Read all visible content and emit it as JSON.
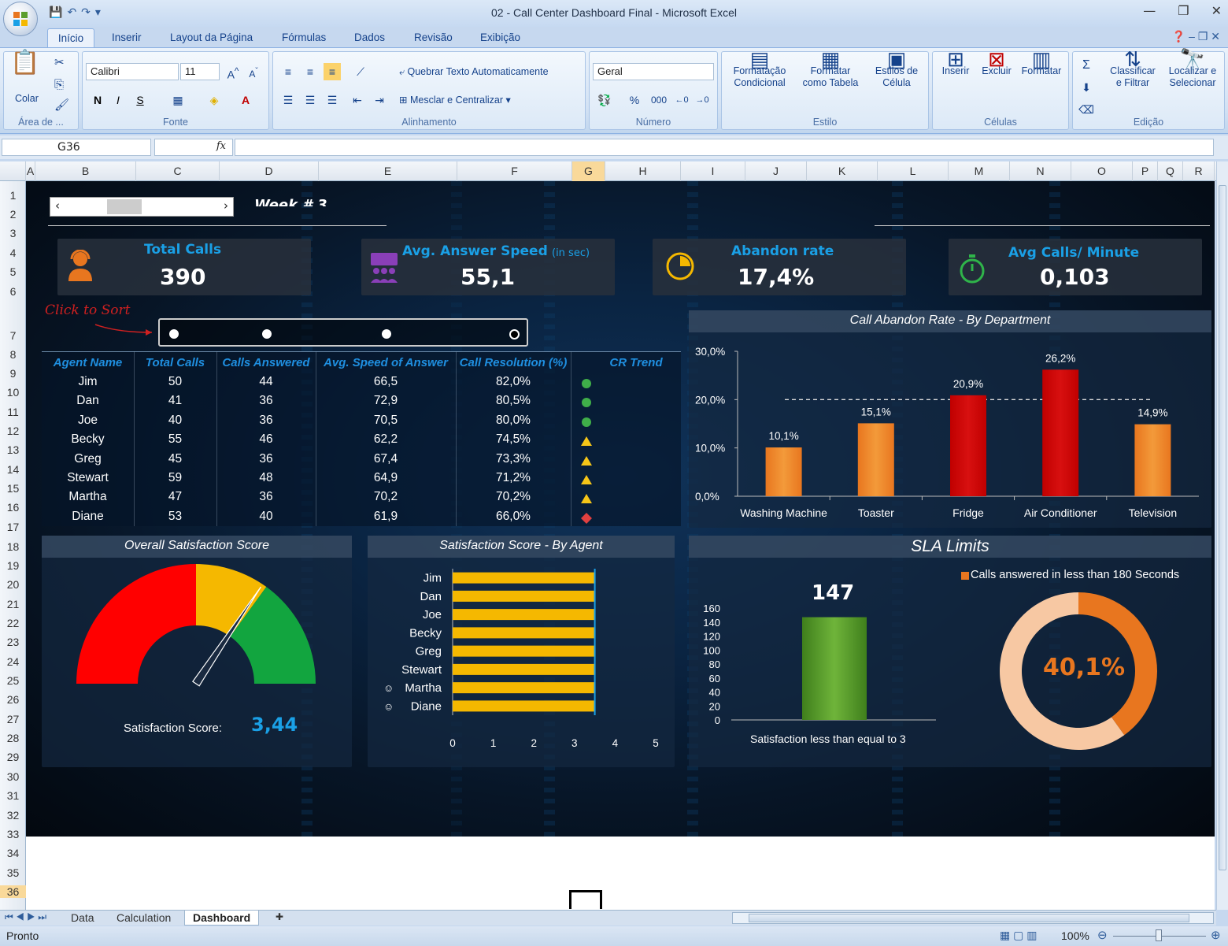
{
  "window": {
    "title": "02 - Call Center Dashboard Final - Microsoft Excel"
  },
  "ribbon": {
    "tabs": [
      "Início",
      "Inserir",
      "Layout da Página",
      "Fórmulas",
      "Dados",
      "Revisão",
      "Exibição"
    ],
    "clipboard": {
      "paste": "Colar",
      "group": "Área de ..."
    },
    "font": {
      "name": "Calibri",
      "size": "11",
      "bold": "N",
      "italic": "I",
      "underline": "S",
      "group": "Fonte"
    },
    "alignment": {
      "wrap": "Quebrar Texto Automaticamente",
      "merge": "Mesclar e Centralizar",
      "group": "Alinhamento"
    },
    "number": {
      "format": "Geral",
      "percent": "%",
      "thousands": "000",
      "group": "Número"
    },
    "styles": {
      "cond_1": "Formatação",
      "cond_2": "Condicional",
      "table_1": "Formatar",
      "table_2": "como Tabela",
      "cell_1": "Estilos de",
      "cell_2": "Célula",
      "group": "Estilo"
    },
    "cells": {
      "insert": "Inserir",
      "delete": "Excluir",
      "format": "Formatar",
      "group": "Células"
    },
    "editing": {
      "sort_1": "Classificar",
      "sort_2": "e Filtrar",
      "find_1": "Localizar e",
      "find_2": "Selecionar",
      "group": "Edição"
    }
  },
  "formula_bar": {
    "name_box": "G36",
    "fx": "fx",
    "formula": ""
  },
  "columns": [
    "A",
    "B",
    "C",
    "D",
    "E",
    "F",
    "G",
    "H",
    "I",
    "J",
    "K",
    "L",
    "M",
    "N",
    "O",
    "P",
    "Q",
    "R"
  ],
  "rows": [
    "1",
    "2",
    "3",
    "4",
    "5",
    "6",
    "7",
    "8",
    "9",
    "10",
    "11",
    "12",
    "13",
    "14",
    "15",
    "16",
    "17",
    "18",
    "19",
    "20",
    "21",
    "22",
    "23",
    "24",
    "25",
    "26",
    "27",
    "28",
    "29",
    "30",
    "31",
    "32",
    "33",
    "34",
    "35",
    "36"
  ],
  "dashboard": {
    "week": "Week # 3",
    "kpis": [
      {
        "title": "Total Calls",
        "value": "390",
        "unit": ""
      },
      {
        "title": "Avg. Answer Speed",
        "value": "55,1",
        "unit": "(in sec)"
      },
      {
        "title": "Abandon rate",
        "value": "17,4%",
        "unit": ""
      },
      {
        "title": "Avg Calls/ Minute",
        "value": "0,103",
        "unit": ""
      }
    ],
    "click_to_sort": "Click to Sort",
    "table": {
      "headers": [
        "Agent Name",
        "Total Calls",
        "Calls Answered",
        "Avg. Speed of Answer",
        "Call Resolution (%)",
        "CR Trend"
      ],
      "rows": [
        [
          "Jim",
          "50",
          "44",
          "66,5",
          "82,0%",
          "green-circle"
        ],
        [
          "Dan",
          "41",
          "36",
          "72,9",
          "80,5%",
          "green-circle"
        ],
        [
          "Joe",
          "40",
          "36",
          "70,5",
          "80,0%",
          "green-circle"
        ],
        [
          "Becky",
          "55",
          "46",
          "62,2",
          "74,5%",
          "yellow-triangle"
        ],
        [
          "Greg",
          "45",
          "36",
          "67,4",
          "73,3%",
          "yellow-triangle"
        ],
        [
          "Stewart",
          "59",
          "48",
          "64,9",
          "71,2%",
          "yellow-triangle"
        ],
        [
          "Martha",
          "47",
          "36",
          "70,2",
          "70,2%",
          "yellow-triangle"
        ],
        [
          "Diane",
          "53",
          "40",
          "61,9",
          "66,0%",
          "red-diamond"
        ]
      ]
    },
    "gauge": {
      "title": "Overall Satisfaction Score",
      "label": "Satisfaction Score:",
      "value": "3,44",
      "score": 3.44,
      "max": 5
    },
    "sla": {
      "title": "SLA Limits",
      "legend": "Calls answered in less than 180 Seconds",
      "bar_label": "Satisfaction less than equal to 3",
      "bar_value": "147",
      "donut_value": "40,1%"
    }
  },
  "chart_data": [
    {
      "type": "bar",
      "title": "Call Abandon Rate - By Department",
      "categories": [
        "Washing Machine",
        "Toaster",
        "Fridge",
        "Air Conditioner",
        "Television"
      ],
      "values": [
        10.1,
        15.1,
        20.9,
        26.2,
        14.9
      ],
      "labels": [
        "10,1%",
        "15,1%",
        "20,9%",
        "26,2%",
        "14,9%"
      ],
      "colors": [
        "#e8761f",
        "#e8761f",
        "#c00000",
        "#c00000",
        "#e8761f"
      ],
      "ylim": [
        0,
        30
      ],
      "yticks": [
        "0,0%",
        "10,0%",
        "20,0%",
        "30,0%"
      ],
      "reference_line": 20
    },
    {
      "type": "bar",
      "title": "Satisfaction Score - By Agent",
      "orientation": "horizontal",
      "categories": [
        "Jim",
        "Dan",
        "Joe",
        "Becky",
        "Greg",
        "Stewart",
        "Martha",
        "Diane"
      ],
      "values": [
        3.5,
        3.5,
        3.5,
        3.5,
        3.5,
        3.5,
        3.5,
        3.5
      ],
      "xlim": [
        0,
        5
      ],
      "xticks": [
        "0",
        "1",
        "2",
        "3",
        "4",
        "5"
      ]
    },
    {
      "type": "bar",
      "categories": [
        "Satisfaction less than equal to 3"
      ],
      "values": [
        147
      ],
      "ylim": [
        0,
        160
      ],
      "yticks": [
        "0",
        "20",
        "40",
        "60",
        "80",
        "100",
        "120",
        "140",
        "160"
      ]
    },
    {
      "type": "pie",
      "values": [
        40.1,
        59.9
      ],
      "labels": [
        "40,1%"
      ],
      "colors": [
        "#e8761f",
        "#f7c8a3"
      ]
    }
  ],
  "sheet_tabs": [
    "Data",
    "Calculation",
    "Dashboard"
  ],
  "status": {
    "ready": "Pronto",
    "zoom": "100%"
  },
  "colors": {
    "accent": "#1aa0e6",
    "orange": "#e8761f",
    "red": "#c00000",
    "green": "#5c9e2c",
    "gauge_yellow": "#f5b800"
  }
}
